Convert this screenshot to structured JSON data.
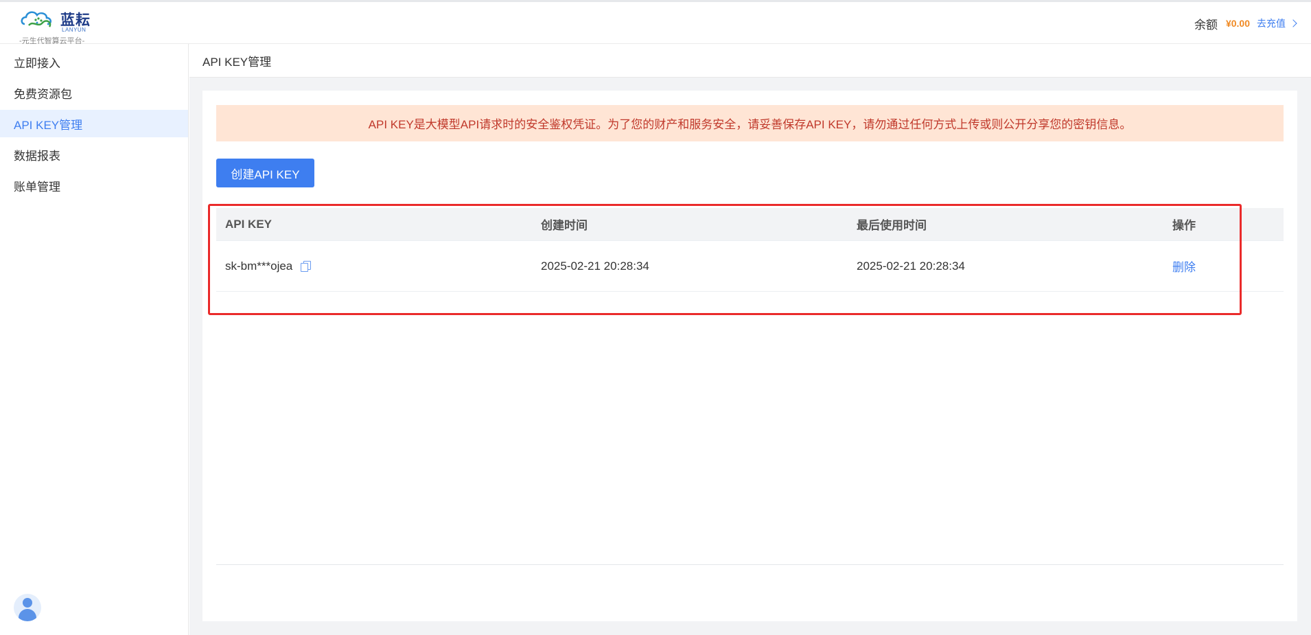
{
  "header": {
    "logo_name": "蓝耘",
    "logo_en": "LANYUN",
    "logo_slogan": "-元生代智算云平台-",
    "balance_label": "余额",
    "balance_value": "¥0.00",
    "recharge_label": "去充值"
  },
  "sidebar": {
    "items": [
      {
        "label": "立即接入",
        "active": false
      },
      {
        "label": "免费资源包",
        "active": false
      },
      {
        "label": "API KEY管理",
        "active": true
      },
      {
        "label": "数据报表",
        "active": false
      },
      {
        "label": "账单管理",
        "active": false
      }
    ]
  },
  "main": {
    "page_title": "API KEY管理",
    "alert_text": "API KEY是大模型API请求时的安全鉴权凭证。为了您的财产和服务安全，请妥善保存API KEY，请勿通过任何方式上传或则公开分享您的密钥信息。",
    "create_button_label": "创建API KEY",
    "table": {
      "columns": [
        "API KEY",
        "创建时间",
        "最后使用时间",
        "操作"
      ],
      "rows": [
        {
          "api_key": "sk-bm***ojea",
          "created_at": "2025-02-21 20:28:34",
          "last_used_at": "2025-02-21 20:28:34",
          "action": "删除"
        }
      ]
    }
  },
  "colors": {
    "accent": "#3e7ef0",
    "alert_bg": "#ffe5d5",
    "alert_text": "#c0392b",
    "balance": "#f08a24",
    "highlight_border": "#ea2a2a"
  },
  "icons": [
    "lanyun-logo-icon",
    "chevron-right-icon",
    "copy-icon",
    "user-avatar-icon"
  ]
}
